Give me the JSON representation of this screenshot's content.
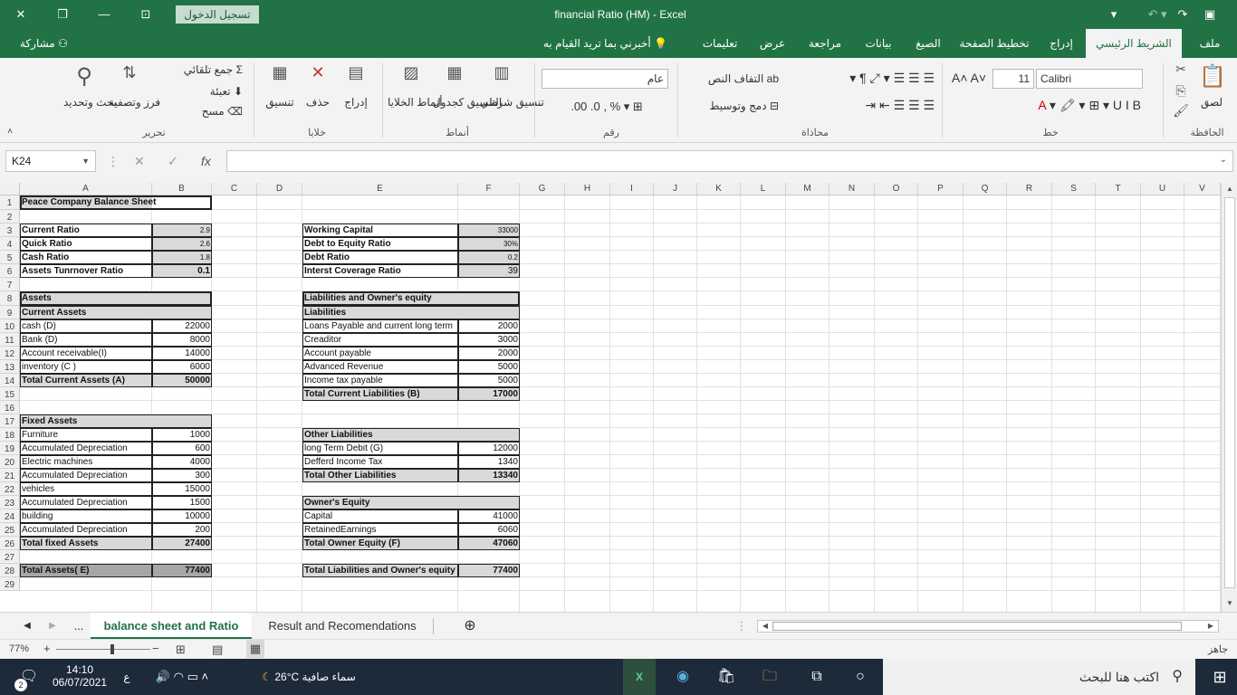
{
  "window": {
    "title": "financial Ratio (HM)  -  Excel",
    "signin": "تسجيل الدخول"
  },
  "ribbon_tabs": {
    "file": "ملف",
    "home": "الشريط الرئيسي",
    "insert": "إدراج",
    "page_layout": "تخطيط الصفحة",
    "formulas": "الصيغ",
    "data": "بيانات",
    "review": "مراجعة",
    "view": "عرض",
    "help": "تعليمات",
    "tell_me": "أخبرني بما تريد القيام به",
    "share": "مشاركة"
  },
  "ribbon": {
    "clipboard": {
      "label": "الحافظة",
      "paste": "لصق"
    },
    "font": {
      "label": "خط",
      "name": "Calibri",
      "size": "11"
    },
    "alignment": {
      "label": "محاذاة",
      "wrap": "التفاف النص",
      "merge": "دمج وتوسيط"
    },
    "number": {
      "label": "رقم",
      "format": "عام"
    },
    "styles": {
      "label": "أنماط",
      "conditional": "تنسيق شرطي",
      "table": "التنسيق كجدول",
      "cell_styles": "أنماط الخلايا"
    },
    "cells": {
      "label": "خلايا",
      "insert": "إدراج",
      "delete": "حذف",
      "format": "تنسيق"
    },
    "editing": {
      "label": "تحرير",
      "autosum": "جمع تلقائي",
      "fill": "تعبئة",
      "clear": "مسح",
      "sort": "فرز وتصفية",
      "find": "بحث وتحديد"
    }
  },
  "formula_bar": {
    "name_box": "K24",
    "fx": "fx",
    "value": ""
  },
  "columns": [
    "A",
    "B",
    "C",
    "D",
    "E",
    "F",
    "G",
    "H",
    "I",
    "J",
    "K",
    "L",
    "M",
    "N",
    "O",
    "P",
    "Q",
    "R",
    "S",
    "T",
    "U",
    "V"
  ],
  "rows": [
    "1",
    "2",
    "3",
    "4",
    "5",
    "6",
    "7",
    "8",
    "9",
    "10",
    "11",
    "12",
    "13",
    "14",
    "15",
    "16",
    "17",
    "18",
    "19",
    "20",
    "21",
    "22",
    "23",
    "24",
    "25",
    "26",
    "27",
    "28",
    "29"
  ],
  "sheet": {
    "title": "Peace Company Balance Sheet",
    "ratios_left": [
      {
        "label": "Current Ratio",
        "value": "2.9"
      },
      {
        "label": "Quick Ratio",
        "value": "2.6"
      },
      {
        "label": "Cash Ratio",
        "value": "1.8"
      },
      {
        "label": "Assets Tunrnover Ratio",
        "value": "0.1"
      }
    ],
    "ratios_right": [
      {
        "label": "Working Capital",
        "value": "33000"
      },
      {
        "label": "Debt to Equity Ratio",
        "value": "30%"
      },
      {
        "label": "Debt Ratio",
        "value": "0.2"
      },
      {
        "label": "Interst Coverage Ratio",
        "value": "39"
      }
    ],
    "assets_header": "Assets",
    "current_assets_header": "Current Assets",
    "current_assets": [
      {
        "label": "cash (D)",
        "value": "22000"
      },
      {
        "label": "Bank (D)",
        "value": "8000"
      },
      {
        "label": "Account receivable(I)",
        "value": "14000"
      },
      {
        "label": " inventory (C )",
        "value": "6000"
      }
    ],
    "total_current_assets": {
      "label": "Total  Current Assets (A)",
      "value": "50000"
    },
    "fixed_assets_header": "Fixed Assets",
    "fixed_assets": [
      {
        "label": "Furniture",
        "value": "1000"
      },
      {
        "label": " Accumulated Depreciation",
        "value": "600"
      },
      {
        "label": "Electric machines",
        "value": "4000"
      },
      {
        "label": "Accumulated Depreciation",
        "value": "300"
      },
      {
        "label": "vehicles",
        "value": "15000"
      },
      {
        "label": "Accumulated Depreciation",
        "value": "1500"
      },
      {
        "label": "building",
        "value": "10000"
      },
      {
        "label": "Accumulated Depreciation",
        "value": "200"
      }
    ],
    "total_fixed_assets": {
      "label": "Total fixed Assets",
      "value": "27400"
    },
    "total_assets": {
      "label": "Total Assets( E)",
      "value": "77400"
    },
    "liab_header": "Liabilities and Owner's equity",
    "liabilities_header": "Liabilities",
    "liabilities": [
      {
        "label": "Loans Payable and current long term",
        "value": "2000"
      },
      {
        "label": "Creaditor",
        "value": "3000"
      },
      {
        "label": "Account payable",
        "value": "2000"
      },
      {
        "label": "Advanced Revenue",
        "value": "5000"
      },
      {
        "label": "Income tax payable",
        "value": "5000"
      }
    ],
    "total_current_liab": {
      "label": "Total Current Liabilities (B)",
      "value": "17000"
    },
    "other_liab_header": "Other Liabilities",
    "other_liab": [
      {
        "label": "long Term Debit (G)",
        "value": "12000"
      },
      {
        "label": "Defferd Income Tax",
        "value": "1340"
      }
    ],
    "total_other_liab": {
      "label": "Total Other Liabilities",
      "value": "13340"
    },
    "equity_header": "Owner's  Equity",
    "equity": [
      {
        "label": "Capital",
        "value": "41000"
      },
      {
        "label": "RetainedEarnings",
        "value": "6060"
      }
    ],
    "total_equity": {
      "label": "Total Owner Equity (F)",
      "value": "47060"
    },
    "total_liab_equity": {
      "label": "Total Liabilities and Owner's equity",
      "value": "77400"
    }
  },
  "sheet_tabs": {
    "more": "...",
    "active": "balance sheet and Ratio",
    "other": "Result and Recomendations"
  },
  "status": {
    "zoom": "77%",
    "ready": "جاهز"
  },
  "taskbar": {
    "search": "اكتب هنا للبحث",
    "weather": "سماء صافية",
    "temp": "26°C",
    "time": "14:10",
    "date": "06/07/2021",
    "lang": "ع",
    "notif": "2"
  }
}
